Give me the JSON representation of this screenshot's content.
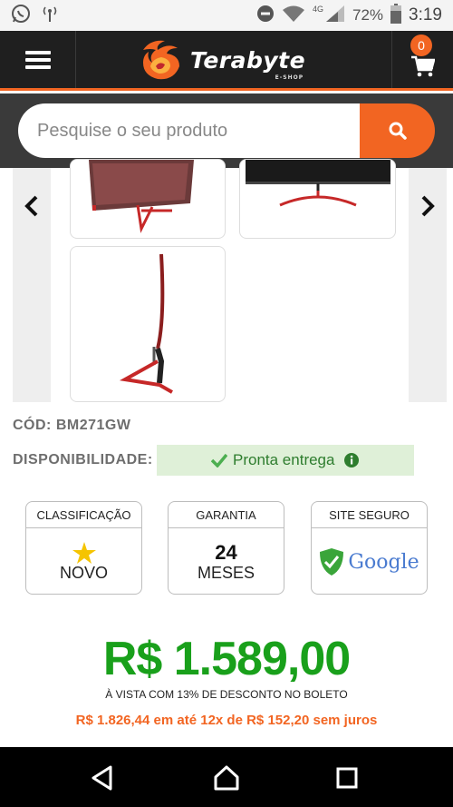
{
  "status_bar": {
    "network_type": "4G",
    "battery": "72%",
    "time": "3:19"
  },
  "header": {
    "logo_text": "Terabyte",
    "logo_subtext": "E-SHOP",
    "cart_count": "0"
  },
  "search": {
    "placeholder": "Pesquise o seu produto"
  },
  "product": {
    "code_label": "CÓD: BM271GW",
    "availability_label": "DISPONIBILIDADE:",
    "availability_value": "Pronta entrega",
    "cards": [
      {
        "title": "CLASSIFICAÇÃO",
        "value": "NOVO",
        "icon": "star-icon"
      },
      {
        "title": "GARANTIA",
        "number": "24",
        "value": "MESES"
      },
      {
        "title": "SITE SEGURO",
        "value": "Google",
        "icon": "shield-icon"
      }
    ],
    "price": "R$ 1.589,00",
    "cash_note": "À VISTA COM 13% DE DESCONTO NO BOLETO",
    "installments": "R$ 1.826,44 em até 12x de R$ 152,20 sem juros"
  },
  "colors": {
    "accent": "#f26522",
    "header_bg": "#1f1f1f",
    "price_green": "#19a01b",
    "availability_bg": "#dff0d8"
  }
}
